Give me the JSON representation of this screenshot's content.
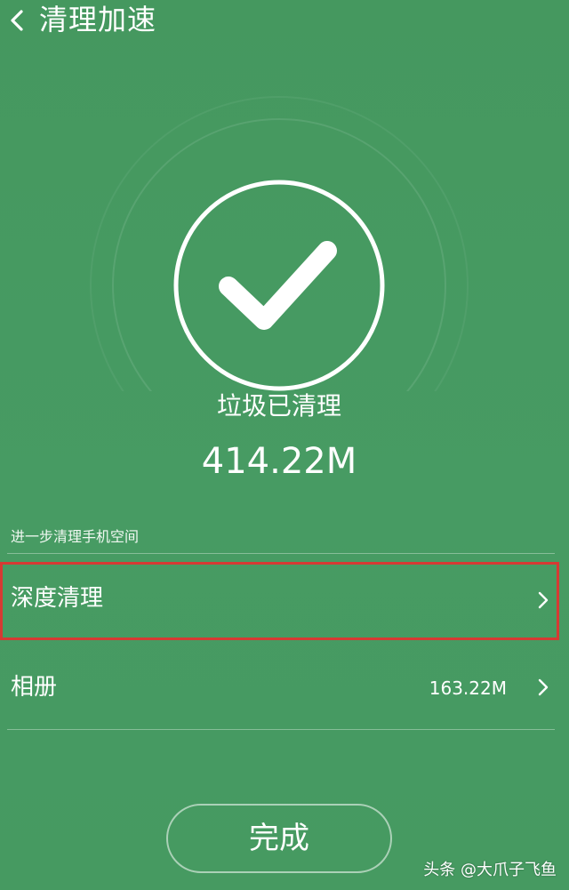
{
  "header": {
    "title": "清理加速",
    "back_icon": "chevron-left-icon"
  },
  "result": {
    "label": "垃圾已清理",
    "size": "414.22M",
    "icon": "checkmark-circle-icon"
  },
  "section": {
    "title": "进一步清理手机空间"
  },
  "list": {
    "items": [
      {
        "label": "深度清理",
        "value": "",
        "icon": "chevron-right-icon",
        "highlighted": true
      },
      {
        "label": "相册",
        "value": "163.22M",
        "icon": "chevron-right-icon",
        "highlighted": false
      }
    ]
  },
  "footer": {
    "done_label": "完成"
  },
  "watermark": {
    "text": "头条 @大爪子飞鱼"
  },
  "colors": {
    "background": "#469a62",
    "foreground": "#ffffff",
    "highlight": "#d63a33"
  }
}
